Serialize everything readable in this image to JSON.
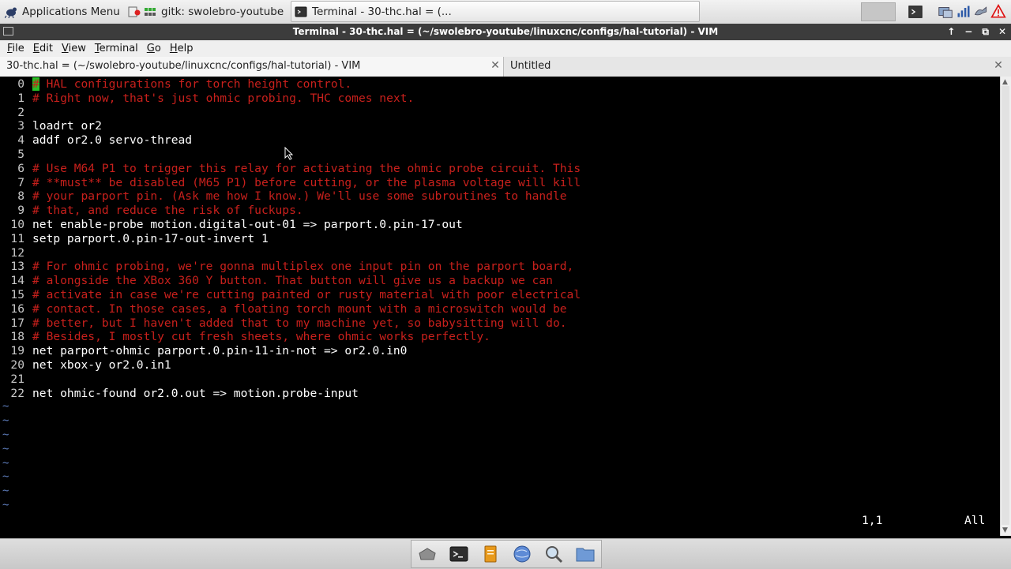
{
  "top_panel": {
    "apps_menu": "Applications Menu",
    "tasks": [
      {
        "label": "gitk: swolebro-youtube"
      },
      {
        "label": "Terminal - 30-thc.hal = (..."
      }
    ]
  },
  "window": {
    "title": "Terminal - 30-thc.hal = (~/swolebro-youtube/linuxcnc/configs/hal-tutorial) - VIM",
    "controls": [
      "↑",
      "−",
      "⧉",
      "✕"
    ]
  },
  "menubar": [
    "File",
    "Edit",
    "View",
    "Terminal",
    "Go",
    "Help"
  ],
  "tabs": [
    {
      "label": "30-thc.hal = (~/swolebro-youtube/linuxcnc/configs/hal-tutorial) - VIM",
      "close": "✕"
    },
    {
      "label": "Untitled",
      "close": "✕"
    }
  ],
  "editor": {
    "lines": [
      {
        "n": "0",
        "text": " HAL configurations for torch height control.",
        "comment": true,
        "cursor": "#"
      },
      {
        "n": "1",
        "text": "# Right now, that's just ohmic probing. THC comes next.",
        "comment": true
      },
      {
        "n": "2",
        "text": "",
        "comment": false
      },
      {
        "n": "3",
        "text": "loadrt or2",
        "comment": false
      },
      {
        "n": "4",
        "text": "addf or2.0 servo-thread",
        "comment": false
      },
      {
        "n": "5",
        "text": "",
        "comment": false
      },
      {
        "n": "6",
        "text": "# Use M64 P1 to trigger this relay for activating the ohmic probe circuit. This",
        "comment": true
      },
      {
        "n": "7",
        "text": "# **must** be disabled (M65 P1) before cutting, or the plasma voltage will kill",
        "comment": true
      },
      {
        "n": "8",
        "text": "# your parport pin. (Ask me how I know.) We'll use some subroutines to handle",
        "comment": true
      },
      {
        "n": "9",
        "text": "# that, and reduce the risk of fuckups.",
        "comment": true
      },
      {
        "n": "10",
        "text": "net enable-probe motion.digital-out-01 => parport.0.pin-17-out",
        "comment": false
      },
      {
        "n": "11",
        "text": "setp parport.0.pin-17-out-invert 1",
        "comment": false
      },
      {
        "n": "12",
        "text": "",
        "comment": false
      },
      {
        "n": "13",
        "text": "# For ohmic probing, we're gonna multiplex one input pin on the parport board,",
        "comment": true
      },
      {
        "n": "14",
        "text": "# alongside the XBox 360 Y button. That button will give us a backup we can",
        "comment": true
      },
      {
        "n": "15",
        "text": "# activate in case we're cutting painted or rusty material with poor electrical",
        "comment": true
      },
      {
        "n": "16",
        "text": "# contact. In those cases, a floating torch mount with a microswitch would be",
        "comment": true
      },
      {
        "n": "17",
        "text": "# better, but I haven't added that to my machine yet, so babysitting will do.",
        "comment": true
      },
      {
        "n": "18",
        "text": "# Besides, I mostly cut fresh sheets, where ohmic works perfectly.",
        "comment": true
      },
      {
        "n": "19",
        "text": "net parport-ohmic parport.0.pin-11-in-not => or2.0.in0",
        "comment": false
      },
      {
        "n": "20",
        "text": "net xbox-y or2.0.in1",
        "comment": false
      },
      {
        "n": "21",
        "text": "",
        "comment": false
      },
      {
        "n": "22",
        "text": "net ohmic-found or2.0.out => motion.probe-input",
        "comment": false
      }
    ],
    "tilde_lines": [
      "~",
      "~",
      "~",
      "~",
      "~",
      "~",
      "~",
      "~"
    ],
    "status": {
      "position": "1,1",
      "scroll": "All"
    }
  },
  "colors": {
    "comment": "#c8201c",
    "cursor": "#26c026",
    "tilde": "#5c7ab8",
    "titlebar": "#3c3c3c"
  },
  "icons": {
    "apps": "xfce-mouse-icon",
    "dock": [
      "home-folder-icon",
      "terminal-icon",
      "text-editor-icon",
      "web-browser-icon",
      "search-icon",
      "files-icon"
    ],
    "tray": [
      "window-placeholder",
      "terminal-tray-icon",
      "network-icon",
      "signal-bars-icon",
      "power-icon",
      "warning-icon"
    ]
  }
}
